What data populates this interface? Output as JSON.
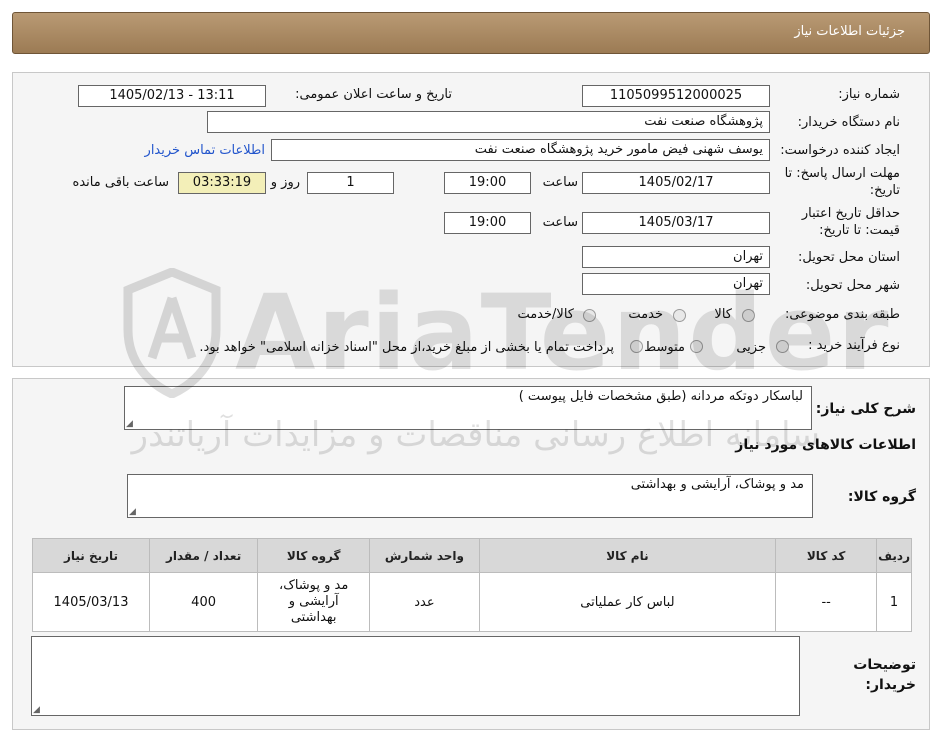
{
  "header": {
    "title": "جزئیات اطلاعات نیاز"
  },
  "form": {
    "need_number_label": "شماره نیاز:",
    "need_number": "1105099512000025",
    "announce_label": "تاریخ و ساعت اعلان عمومی:",
    "announce_value": "1405/02/13 - 13:11",
    "buyer_org_label": "نام دستگاه خریدار:",
    "buyer_org": "پژوهشگاه صنعت نفت",
    "creator_label": "ایجاد کننده درخواست:",
    "creator": "یوسف شهنی فیض مامور خرید پژوهشگاه صنعت نفت",
    "contact_link": "اطلاعات تماس خریدار",
    "deadline_label_1": "مهلت ارسال پاسخ: تا",
    "deadline_label_2": "تاریخ:",
    "deadline_date": "1405/02/17",
    "time_label": "ساعت",
    "deadline_time": "19:00",
    "days_value": "1",
    "days_label": "روز و",
    "remaining_time": "03:33:19",
    "remaining_label": "ساعت باقی مانده",
    "validity_label_1": "حداقل تاریخ اعتبار",
    "validity_label_2": "قیمت: تا تاریخ:",
    "validity_date": "1405/03/17",
    "validity_time": "19:00",
    "province_label": "استان محل تحویل:",
    "province": "تهران",
    "city_label": "شهر محل تحویل:",
    "city": "تهران",
    "category_label": "طبقه بندی موضوعی:",
    "category_options": [
      "کالا",
      "خدمت",
      "کالا/خدمت"
    ],
    "process_label": "نوع فرآیند خرید :",
    "process_options": [
      "جزیی",
      "متوسط",
      "پرداخت تمام یا بخشی از مبلغ خرید،از محل \"اسناد خزانه اسلامی\" خواهد بود."
    ]
  },
  "summary": {
    "label": "شرح کلی نیاز:",
    "text": "لباسکار دوتکه مردانه (طبق مشخصات فایل پیوست )",
    "items_title": "اطلاعات کالاهای مورد نیاز",
    "group_label": "گروه کالا:",
    "group_value": "مد و پوشاک، آرایشی و بهداشتی"
  },
  "table": {
    "headers": [
      "ردیف",
      "کد کالا",
      "نام کالا",
      "واحد شمارش",
      "گروه کالا",
      "تعداد / مقدار",
      "تاریخ نیاز"
    ],
    "rows": [
      [
        "1",
        "--",
        "لباس کار عملیاتی",
        "عدد",
        "مد و پوشاک، آرایشی و بهداشتی",
        "400",
        "1405/03/13"
      ]
    ]
  },
  "notes": {
    "label_1": "توضیحات",
    "label_2": "خریدار:",
    "value": ""
  },
  "watermark": {
    "brand": "AriaTender",
    "subtitle": "سامانه اطلاع رسانی مناقصات و مزایدات آریاتندر"
  }
}
